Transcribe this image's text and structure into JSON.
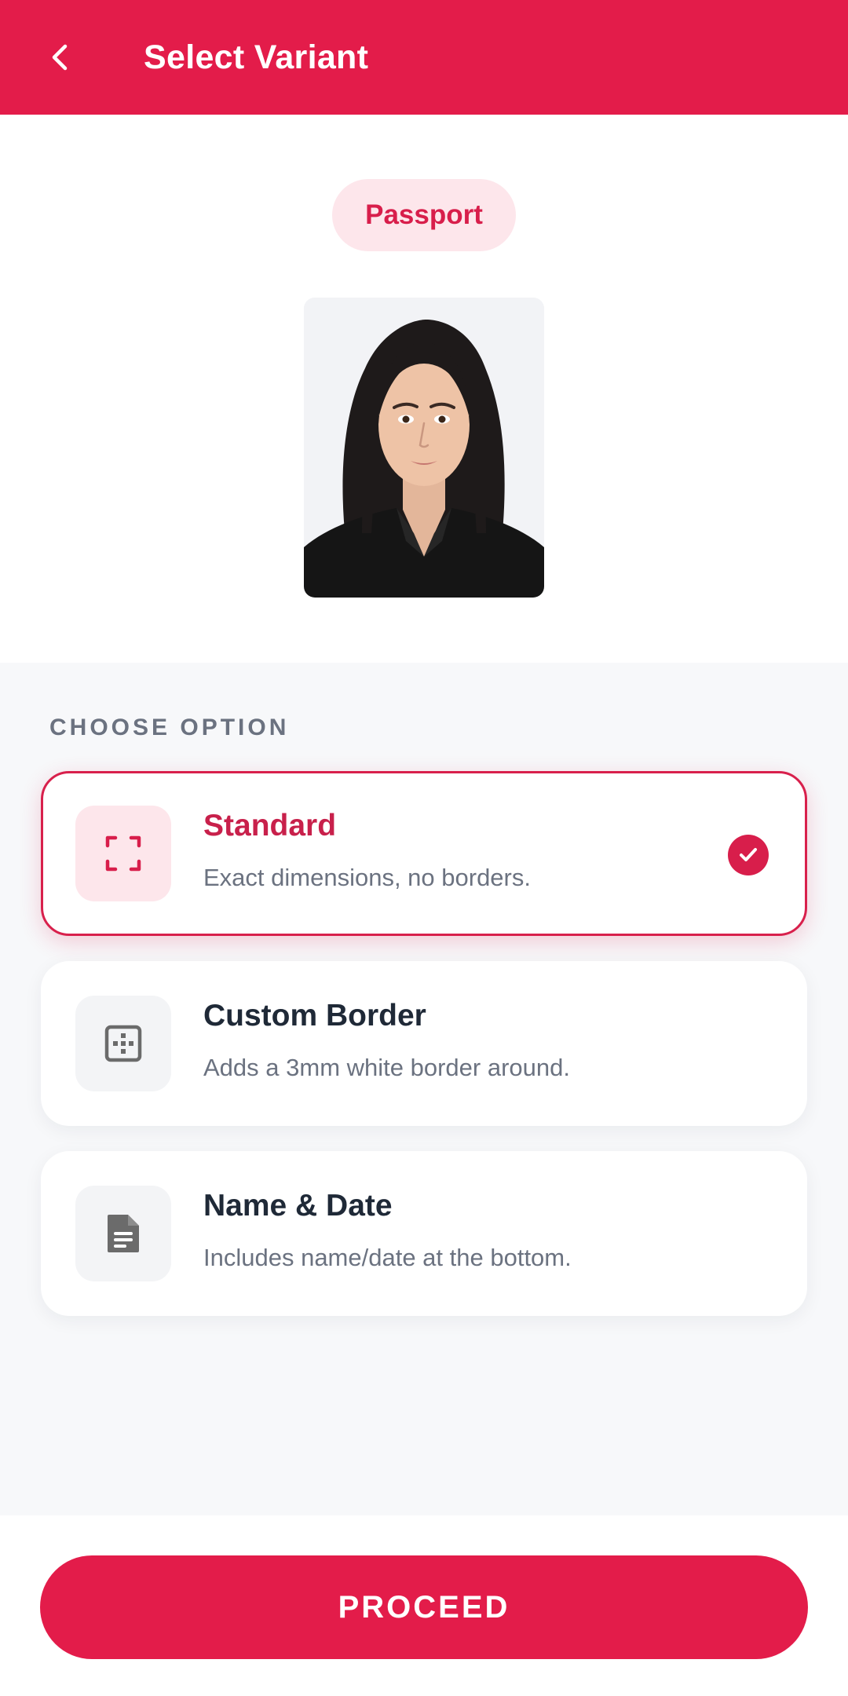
{
  "app_bar": {
    "title": "Select Variant",
    "back_icon": "chevron-left-icon",
    "color": "#e31c4a"
  },
  "preview": {
    "document_type": "Passport",
    "photo_description_icon": "passport-photo"
  },
  "options_section": {
    "label": "CHOOSE OPTION",
    "options": [
      {
        "title": "Standard",
        "description": "Exact dimensions, no borders.",
        "icon": "crop-corners-icon",
        "selected": true
      },
      {
        "title": "Custom Border",
        "description": "Adds a 3mm white border around.",
        "icon": "border-grid-icon",
        "selected": false
      },
      {
        "title": "Name & Date",
        "description": "Includes name/date at the bottom.",
        "icon": "document-icon",
        "selected": false
      }
    ]
  },
  "footer": {
    "proceed_label": "PROCEED"
  },
  "colors": {
    "accent": "#e31c4a",
    "accent_light": "#fde6eb",
    "text_dark": "#1f2937",
    "text_muted": "#6b7280"
  }
}
